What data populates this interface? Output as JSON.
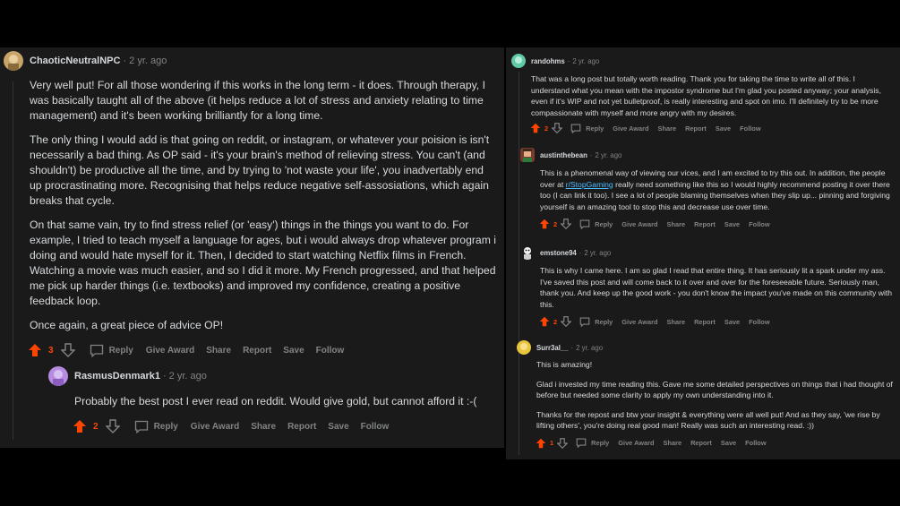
{
  "left": {
    "comment1": {
      "author": "ChaoticNeutralNPC",
      "time": "2 yr. ago",
      "paragraphs": [
        "Very well put! For all those wondering if this works in the long term - it does. Through therapy, I was basically taught all of the above (it helps reduce a lot of stress and anxiety relating to time management) and it's been working brilliantly for a long time.",
        "The only thing I would add is that going on reddit, or instagram, or whatever your poision is isn't necessarily a bad thing. As OP said - it's your brain's method of relieving stress. You can't (and shouldn't) be productive all the time, and by trying to 'not waste your life', you inadvertably end up procrastinating more. Recognising that helps reduce negative self-assosiations, which again breaks that cycle.",
        "On that same vain, try to find stress relief (or 'easy') things in the things you want to do. For example, I tried to teach myself a language for ages, but i would always drop whatever program i doing and would hate myself for it. Then, I decided to start watching Netflix films in French. Watching a movie was much easier, and so I did it more. My French progressed, and that helped me pick up harder things (i.e. textbooks) and improved my confidence, creating a positive feedback loop.",
        "Once again, a great piece of advice OP!"
      ],
      "score": "3"
    },
    "comment2": {
      "author": "RasmusDenmark1",
      "time": "2 yr. ago",
      "paragraphs": [
        "Probably the best post I ever read on reddit. Would give gold, but cannot afford it :-("
      ],
      "score": "2"
    }
  },
  "right": {
    "comment1": {
      "author": "randohms",
      "time": "2 yr. ago",
      "paragraphs": [
        "That was a long post but totally worth reading. Thank you for taking the time to write all of this. I understand what you mean with the impostor syndrome but I'm glad you posted anyway; your analysis, even if it's WIP and not yet bulletproof, is really interesting and spot on imo. I'll definitely try to be more compassionate with myself and more angry with my desires."
      ],
      "score": "2"
    },
    "comment2": {
      "author": "austinthebean",
      "time": "2 yr. ago",
      "text_before_link": "This is a phenomenal way of viewing our vices, and I am excited to try this out. In addition, the people over at ",
      "link": "r/StopGaming",
      "text_after_link": " really need something like this so I would highly recommend posting it over there too (I can link it too). I see a lot of people blaming themselves when they slip up... pinning and forgiving yourself is an amazing tool to stop this and decrease use over time.",
      "score": "2"
    },
    "comment3": {
      "author": "emstone94",
      "time": "2 yr. ago",
      "paragraphs": [
        "This is why I came here. I am so glad I read that entire thing. It has seriously lit a spark under my ass. I've saved this post and will come back to it over and over for the foreseeable future. Seriously man, thank you. And keep up the good work - you don't know the impact you've made on this community with this."
      ],
      "score": "2"
    },
    "comment4": {
      "author": "Surr3al__",
      "time": "2 yr. ago",
      "paragraphs": [
        "This is amazing!",
        "Glad i invested my time reading this. Gave me some detailed perspectives on things that i had thought of before but needed some clarity to apply my own understanding into it.",
        "Thanks for the repost and btw your insight & everything were all well put! And as they say, 'we rise by lifting others', you're doing real good man! Really was such an interesting read. :))"
      ],
      "score": "1"
    }
  },
  "actions": {
    "reply": "Reply",
    "give_award": "Give Award",
    "share": "Share",
    "report": "Report",
    "save": "Save",
    "follow": "Follow"
  },
  "icons": {
    "upvote": "upvote-arrow-icon",
    "downvote": "downvote-arrow-icon",
    "reply": "speech-bubble-icon"
  },
  "colors": {
    "upvote": "#ff4500",
    "link": "#4fbcff"
  }
}
